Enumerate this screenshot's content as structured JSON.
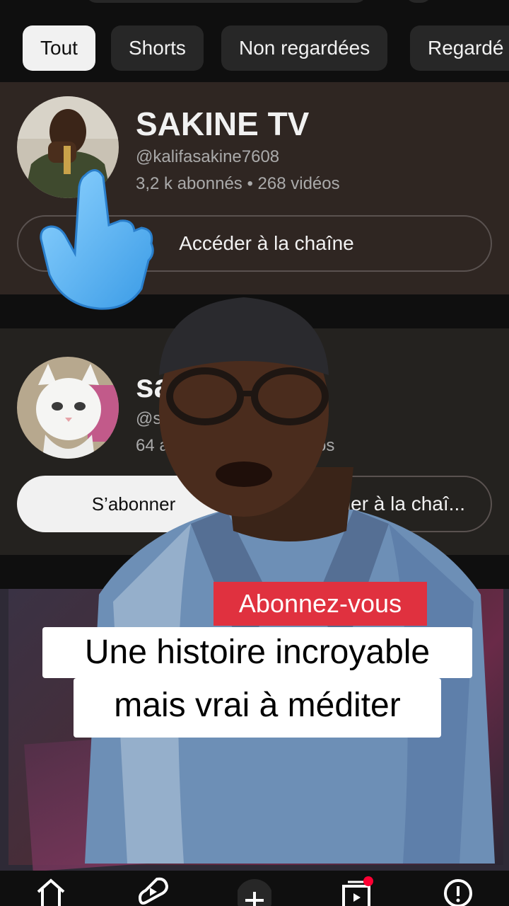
{
  "filter_chips": [
    "Tout",
    "Shorts",
    "Non regardées",
    "Regardé"
  ],
  "channel1": {
    "name": "SAKINE TV",
    "handle": "@kalifasakine7608",
    "stats": "3,2 k abonnés • 268 vidéos",
    "button": "Accéder à la chaîne"
  },
  "channel2": {
    "name_visible": "sa",
    "handle_visible": "@sa",
    "stats_left": "64 ab",
    "stats_right": "os",
    "subscribe_button": "S’abonner",
    "channel_button_visible": "der à la chaî..."
  },
  "overlay": {
    "badge": "Abonnez-vous",
    "caption_line1": "Une histoire incroyable",
    "caption_line2": "mais vrai à méditer"
  },
  "colors": {
    "accent_red": "#e0313f",
    "card1_bg": "#2f2622",
    "card2_bg": "#24221f",
    "chip_bg": "#272727",
    "notification": "#ff0033"
  },
  "icons": [
    "home-icon",
    "shorts-icon",
    "create-icon",
    "subscriptions-icon",
    "info-icon",
    "pointing-hand-icon"
  ]
}
